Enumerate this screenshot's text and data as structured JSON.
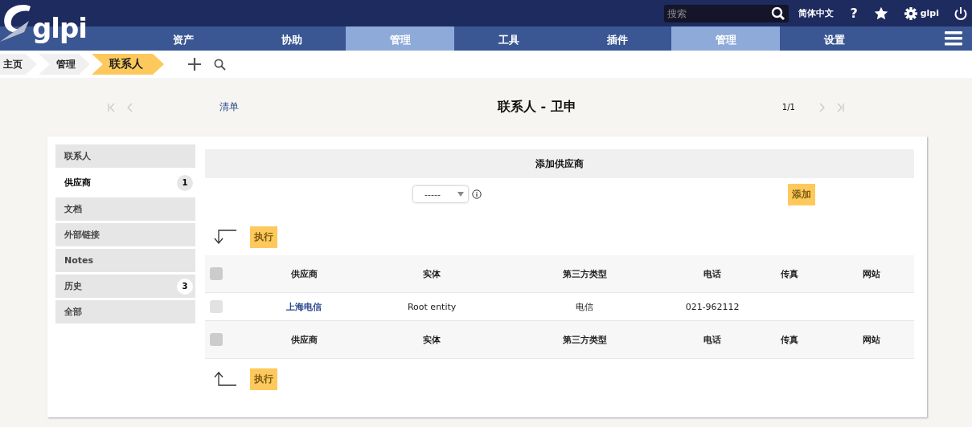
{
  "header": {
    "logo": "glpi",
    "search": {
      "placeholder": "搜索"
    },
    "language": "简体中文",
    "help": "?",
    "user": "glpi"
  },
  "menu": [
    {
      "label": "资产",
      "selected": false
    },
    {
      "label": "协助",
      "selected": false
    },
    {
      "label": "管理",
      "selected": true
    },
    {
      "label": "工具",
      "selected": false
    },
    {
      "label": "插件",
      "selected": false
    },
    {
      "label": "管理",
      "selected": true
    },
    {
      "label": "设置",
      "selected": false
    }
  ],
  "breadcrumb": [
    {
      "label": "主页",
      "selected": false
    },
    {
      "label": "管理",
      "selected": false
    },
    {
      "label": "联系人",
      "selected": true
    }
  ],
  "record_nav": {
    "list_link": "清单",
    "title": "联系人 - 卫申",
    "position": "1/1"
  },
  "sidebar": [
    {
      "label": "联系人",
      "selected": false
    },
    {
      "label": "供应商",
      "selected": true,
      "count": "1"
    },
    {
      "label": "文档",
      "selected": false
    },
    {
      "label": "外部链接",
      "selected": false
    },
    {
      "label": "Notes",
      "selected": false
    },
    {
      "label": "历史",
      "selected": false,
      "count": "3"
    },
    {
      "label": "全部",
      "selected": false
    }
  ],
  "add_section": {
    "title": "添加供应商",
    "dropdown_value": "-----",
    "button": "添加"
  },
  "action_button_top": "执行",
  "table": {
    "header_checked": false,
    "footer_checked": false,
    "columns": [
      "供应商",
      "实体",
      "第三方类型",
      "电话",
      "传真",
      "网站"
    ],
    "footer_columns": [
      "供应商",
      "实体",
      "第三方类型",
      "电话",
      "传真",
      "网站"
    ],
    "rows": [
      {
        "checked": false,
        "cells": [
          "上海电信",
          "Root entity",
          "电信",
          "021-962112",
          "",
          ""
        ]
      }
    ]
  },
  "action_button_bottom": "执行"
}
